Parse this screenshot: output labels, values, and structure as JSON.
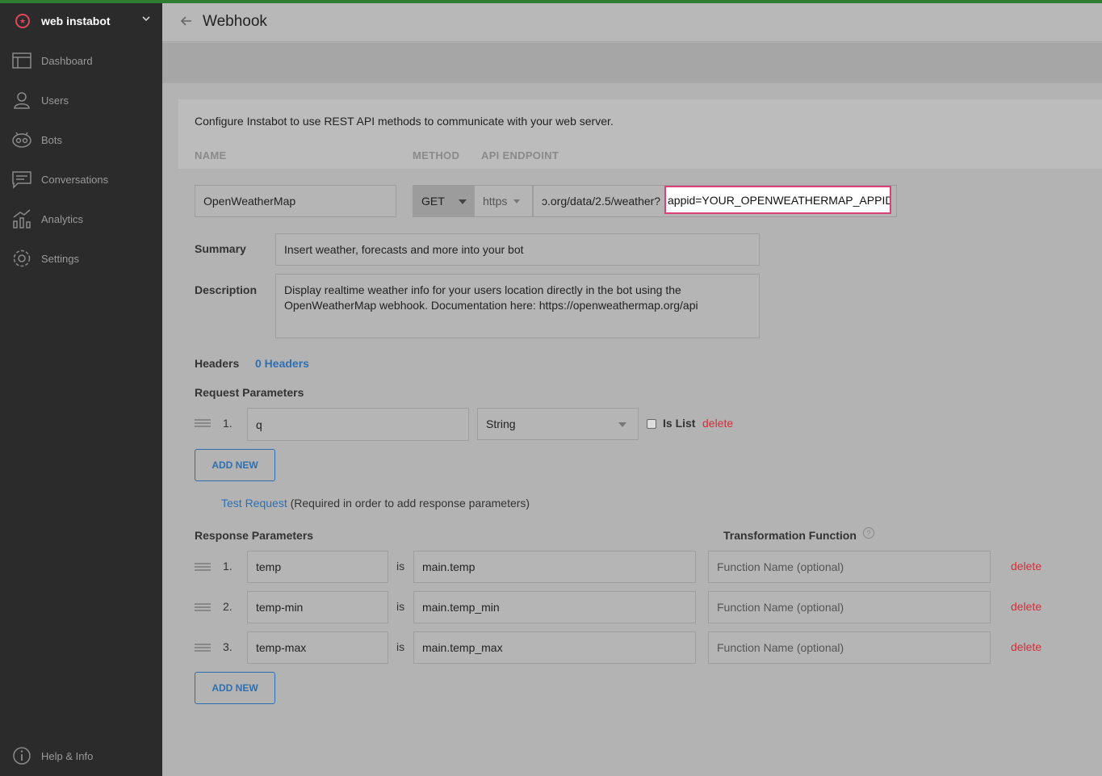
{
  "sidebar": {
    "brand": "web instabot",
    "items": [
      {
        "label": "Dashboard",
        "icon": "dashboard-icon"
      },
      {
        "label": "Users",
        "icon": "user-icon"
      },
      {
        "label": "Bots",
        "icon": "bot-icon"
      },
      {
        "label": "Conversations",
        "icon": "chat-icon"
      },
      {
        "label": "Analytics",
        "icon": "analytics-icon"
      },
      {
        "label": "Settings",
        "icon": "gear-icon"
      }
    ],
    "help": "Help & Info"
  },
  "header": {
    "title": "Webhook"
  },
  "form": {
    "intro": "Configure Instabot to use REST API methods to communicate with your web server.",
    "col_name": "NAME",
    "col_method": "METHOD",
    "col_endpoint": "API ENDPOINT",
    "name": "OpenWeatherMap",
    "method": "GET",
    "protocol": "https",
    "endpoint_prefix": "ɔ.org/data/2.5/weather?",
    "endpoint_highlight": "appid=YOUR_OPENWEATHERMAP_APPID",
    "summary_label": "Summary",
    "summary": "Insert weather, forecasts and more into your bot",
    "description_label": "Description",
    "description_line1": "Display realtime weather info for your users location directly in the bot using the",
    "description_line2": "OpenWeatherMap webhook. Documentation here: https://openweathermap.org/api",
    "headers_label": "Headers",
    "headers_link": "0 Headers",
    "request_label": "Request Parameters",
    "request_params": [
      {
        "num": "1.",
        "name": "q",
        "type": "String",
        "is_list": "Is List",
        "delete": "delete"
      }
    ],
    "add_new": "ADD NEW",
    "test_request": "Test Request",
    "test_note": "(Required in order to add response parameters)",
    "response_label": "Response Parameters",
    "transform_label": "Transformation Function",
    "is_word": "is",
    "response_params": [
      {
        "num": "1.",
        "name": "temp",
        "path": "main.temp",
        "fn_placeholder": "Function Name (optional)",
        "delete": "delete"
      },
      {
        "num": "2.",
        "name": "temp-min",
        "path": "main.temp_min",
        "fn_placeholder": "Function Name (optional)",
        "delete": "delete"
      },
      {
        "num": "3.",
        "name": "temp-max",
        "path": "main.temp_max",
        "fn_placeholder": "Function Name (optional)",
        "delete": "delete"
      }
    ]
  },
  "colors": {
    "accent": "#2f6fb0",
    "danger": "#d0303a",
    "highlight": "#e0407a",
    "sidebar": "#2b2b2b"
  }
}
